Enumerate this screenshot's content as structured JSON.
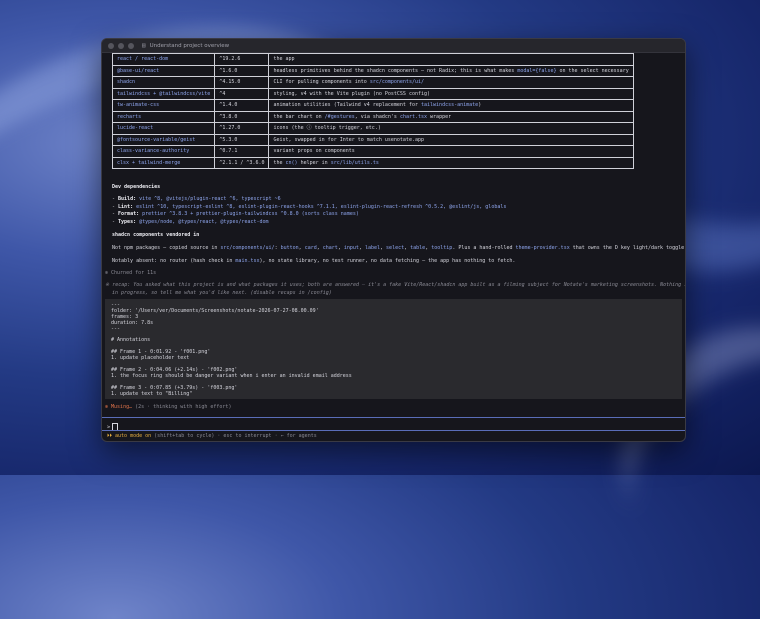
{
  "window": {
    "title": "Understand project overview"
  },
  "deps_table": [
    {
      "name": "react / react-dom",
      "version": "^19.2.6",
      "desc_parts": [
        {
          "t": "the app"
        }
      ]
    },
    {
      "name": "@base-ui/react",
      "version": "^1.6.0",
      "desc_parts": [
        {
          "t": "headless primitives behind the shadcn components — not Radix; this is what makes "
        },
        {
          "t": "modal={false}",
          "code": true
        },
        {
          "t": " on the select necessary"
        }
      ]
    },
    {
      "name": "shadcn",
      "version": "^4.15.0",
      "desc_parts": [
        {
          "t": "CLI for pulling components into "
        },
        {
          "t": "src/components/ui/",
          "code": true
        }
      ]
    },
    {
      "name": "tailwindcss + @tailwindcss/vite",
      "version": "^4",
      "desc_parts": [
        {
          "t": "styling, v4 with the Vite plugin (no PostCSS config)"
        }
      ]
    },
    {
      "name": "tw-animate-css",
      "version": "^1.4.0",
      "desc_parts": [
        {
          "t": "animation utilities (Tailwind v4 replacement for "
        },
        {
          "t": "tailwindcss-animate",
          "code": true
        },
        {
          "t": ")"
        }
      ]
    },
    {
      "name": "recharts",
      "version": "^3.8.0",
      "desc_parts": [
        {
          "t": "the bar chart on "
        },
        {
          "t": "/#gestures",
          "code": true
        },
        {
          "t": ", via shadcn's "
        },
        {
          "t": "chart.tsx",
          "code": true
        },
        {
          "t": " wrapper"
        }
      ]
    },
    {
      "name": "lucide-react",
      "version": "^1.27.0",
      "desc_parts": [
        {
          "t": "icons (the ⓘ tooltip trigger, etc.)"
        }
      ]
    },
    {
      "name": "@fontsource-variable/geist",
      "version": "^5.3.0",
      "desc_parts": [
        {
          "t": "Geist, swapped in for Inter to match usenotate.app"
        }
      ]
    },
    {
      "name": "class-variance-authority",
      "version": "^0.7.1",
      "desc_parts": [
        {
          "t": "variant props on components"
        }
      ]
    },
    {
      "name": "clsx + tailwind-merge",
      "version": "^2.1.1 / ^3.6.0",
      "desc_parts": [
        {
          "t": "the "
        },
        {
          "t": "cn()",
          "code": true
        },
        {
          "t": " helper in "
        },
        {
          "t": "src/lib/utils.ts",
          "code": true
        }
      ]
    }
  ],
  "dev_heading": "Dev dependencies",
  "dev_lines": [
    {
      "label": "Build",
      "text": "vite ^8, @vitejs/plugin-react ^6, typescript ~6"
    },
    {
      "label": "Lint",
      "text": "eslint ^10, typescript-eslint ^8, eslint-plugin-react-hooks ^7.1.1, eslint-plugin-react-refresh ^0.5.2, @eslint/js, globals"
    },
    {
      "label": "Format",
      "text": "prettier ^3.8.3 + prettier-plugin-tailwindcss ^0.8.0 (sorts class names)"
    },
    {
      "label": "Types",
      "text": "@types/node, @types/react, @types/react-dom"
    }
  ],
  "vendored_heading": "shadcn components vendored in",
  "vendored_parts": [
    {
      "t": "Not npm packages — copied source in "
    },
    {
      "t": "src/components/ui/",
      "code": true
    },
    {
      "t": ": "
    },
    {
      "t": "button",
      "code": true
    },
    {
      "t": ", "
    },
    {
      "t": "card",
      "code": true
    },
    {
      "t": ", "
    },
    {
      "t": "chart",
      "code": true
    },
    {
      "t": ", "
    },
    {
      "t": "input",
      "code": true
    },
    {
      "t": ", "
    },
    {
      "t": "label",
      "code": true
    },
    {
      "t": ", "
    },
    {
      "t": "select",
      "code": true
    },
    {
      "t": ", "
    },
    {
      "t": "table",
      "code": true
    },
    {
      "t": ", "
    },
    {
      "t": "tooltip",
      "code": true
    },
    {
      "t": ". Plus a hand-rolled "
    },
    {
      "t": "theme-provider.tsx",
      "code": true
    },
    {
      "t": " that owns the D key light/dark toggle."
    }
  ],
  "absent_parts": [
    {
      "t": "Notably absent: no router (hash check in "
    },
    {
      "t": "main.tsx",
      "code": true
    },
    {
      "t": "), no state library, no test runner, no data fetching — the app has nothing to fetch."
    }
  ],
  "churned": "✻ Churned for 11s",
  "recap_line1": "※ recap: You asked what this project is and what packages it uses; both are answered — it's a fake Vite/React/shadcn app built as a filming subject for Notate's marketing screenshots. Nothing is",
  "recap_line2": "in progress, so tell me what you'd like next. (disable recaps in /config)",
  "panel_lines": [
    "---",
    "folder: '/Users/ver/Documents/Screenshots/notate-2026-07-27-08.00.09'",
    "frames: 3",
    "duration: 7.8s",
    "---",
    "",
    "# Annotations",
    "",
    "## Frame 1 - 0:01.92 - 'f001.png'",
    "1. update placeholder text",
    "",
    "## Frame 2 - 0:04.06 (+2.14s) - 'f002.png'",
    "1. the focus ring should be danger variant when i enter an invalid email address",
    "",
    "## Frame 3 - 0:07.85 (+3.79s) - 'f003.png'",
    "1. update text to \"Billing\""
  ],
  "musing": {
    "icon": "✻",
    "word": "Musing…",
    "detail": "(2s · thinking with high effort)"
  },
  "prompt_symbol": ">",
  "status": {
    "arrows": "⏵⏵",
    "mode": "auto mode on",
    "hint": "(shift+tab to cycle) · esc to interrupt · ← for agents"
  }
}
